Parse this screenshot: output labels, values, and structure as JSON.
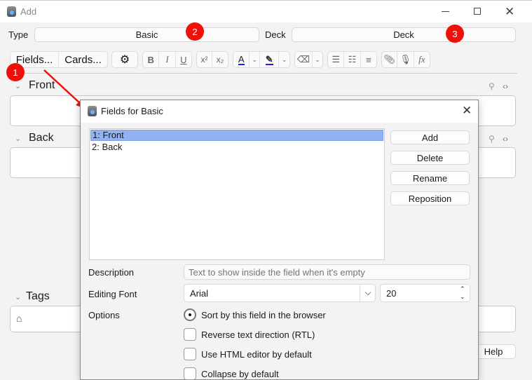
{
  "window": {
    "title": "Add",
    "controls": [
      "minimize",
      "maximize",
      "close"
    ]
  },
  "row": {
    "type_label": "Type",
    "type_value": "Basic",
    "deck_label": "Deck",
    "deck_value": "Deck"
  },
  "toolbar": {
    "fields_label": "Fields...",
    "cards_label": "Cards...",
    "bold": "B",
    "italic": "I",
    "underline": "U",
    "superscript": "x²",
    "subscript": "x₂",
    "text_color": "A",
    "function": "fx"
  },
  "editor": {
    "fields": [
      {
        "label": "Front"
      },
      {
        "label": "Back"
      }
    ],
    "tags_label": "Tags",
    "help_label": "Help"
  },
  "annotations": {
    "badges": [
      "1",
      "2",
      "3"
    ],
    "accent": "#f0100a"
  },
  "dialog": {
    "title": "Fields for Basic",
    "fields": [
      "1: Front",
      "2: Back"
    ],
    "selected_index": 0,
    "buttons": [
      "Add",
      "Delete",
      "Rename",
      "Reposition"
    ],
    "description_label": "Description",
    "description_placeholder": "Text to show inside the field when it's empty",
    "editing_font_label": "Editing Font",
    "font_value": "Arial",
    "font_size": "20",
    "options_label": "Options",
    "options": [
      {
        "label": "Sort by this field in the browser",
        "checked": true
      },
      {
        "label": "Reverse text direction (RTL)",
        "checked": false
      },
      {
        "label": "Use HTML editor by default",
        "checked": false
      },
      {
        "label": "Collapse by default",
        "checked": false
      }
    ]
  }
}
